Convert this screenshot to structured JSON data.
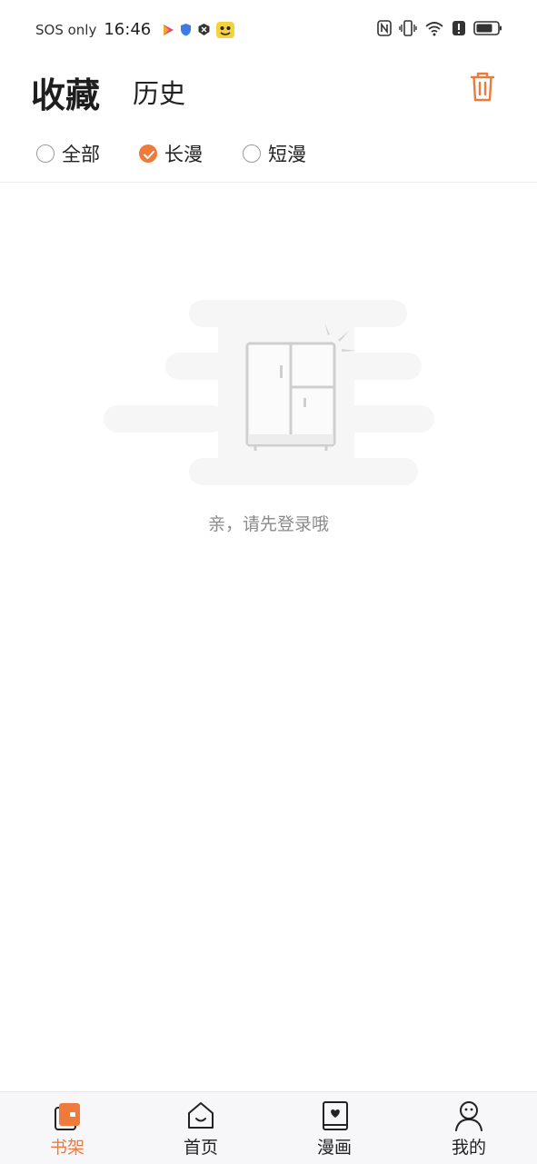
{
  "status_bar": {
    "carrier": "SOS only",
    "time": "16:46"
  },
  "header": {
    "tabs": [
      {
        "label": "收藏",
        "active": true
      },
      {
        "label": "历史",
        "active": false
      }
    ],
    "trash_icon": "trash-icon"
  },
  "filters": [
    {
      "label": "全部",
      "checked": false
    },
    {
      "label": "长漫",
      "checked": true
    },
    {
      "label": "短漫",
      "checked": false
    }
  ],
  "empty_state": {
    "message": "亲，请先登录哦",
    "illustration": "cabinet-icon"
  },
  "bottom_nav": [
    {
      "label": "书架",
      "icon": "bookshelf-icon",
      "active": true
    },
    {
      "label": "首页",
      "icon": "home-icon",
      "active": false
    },
    {
      "label": "漫画",
      "icon": "comic-book-icon",
      "active": false
    },
    {
      "label": "我的",
      "icon": "profile-icon",
      "active": false
    }
  ],
  "colors": {
    "accent": "#f07a3a",
    "nav_active": "#ee7b3c",
    "muted_text": "#8a8a8a"
  }
}
